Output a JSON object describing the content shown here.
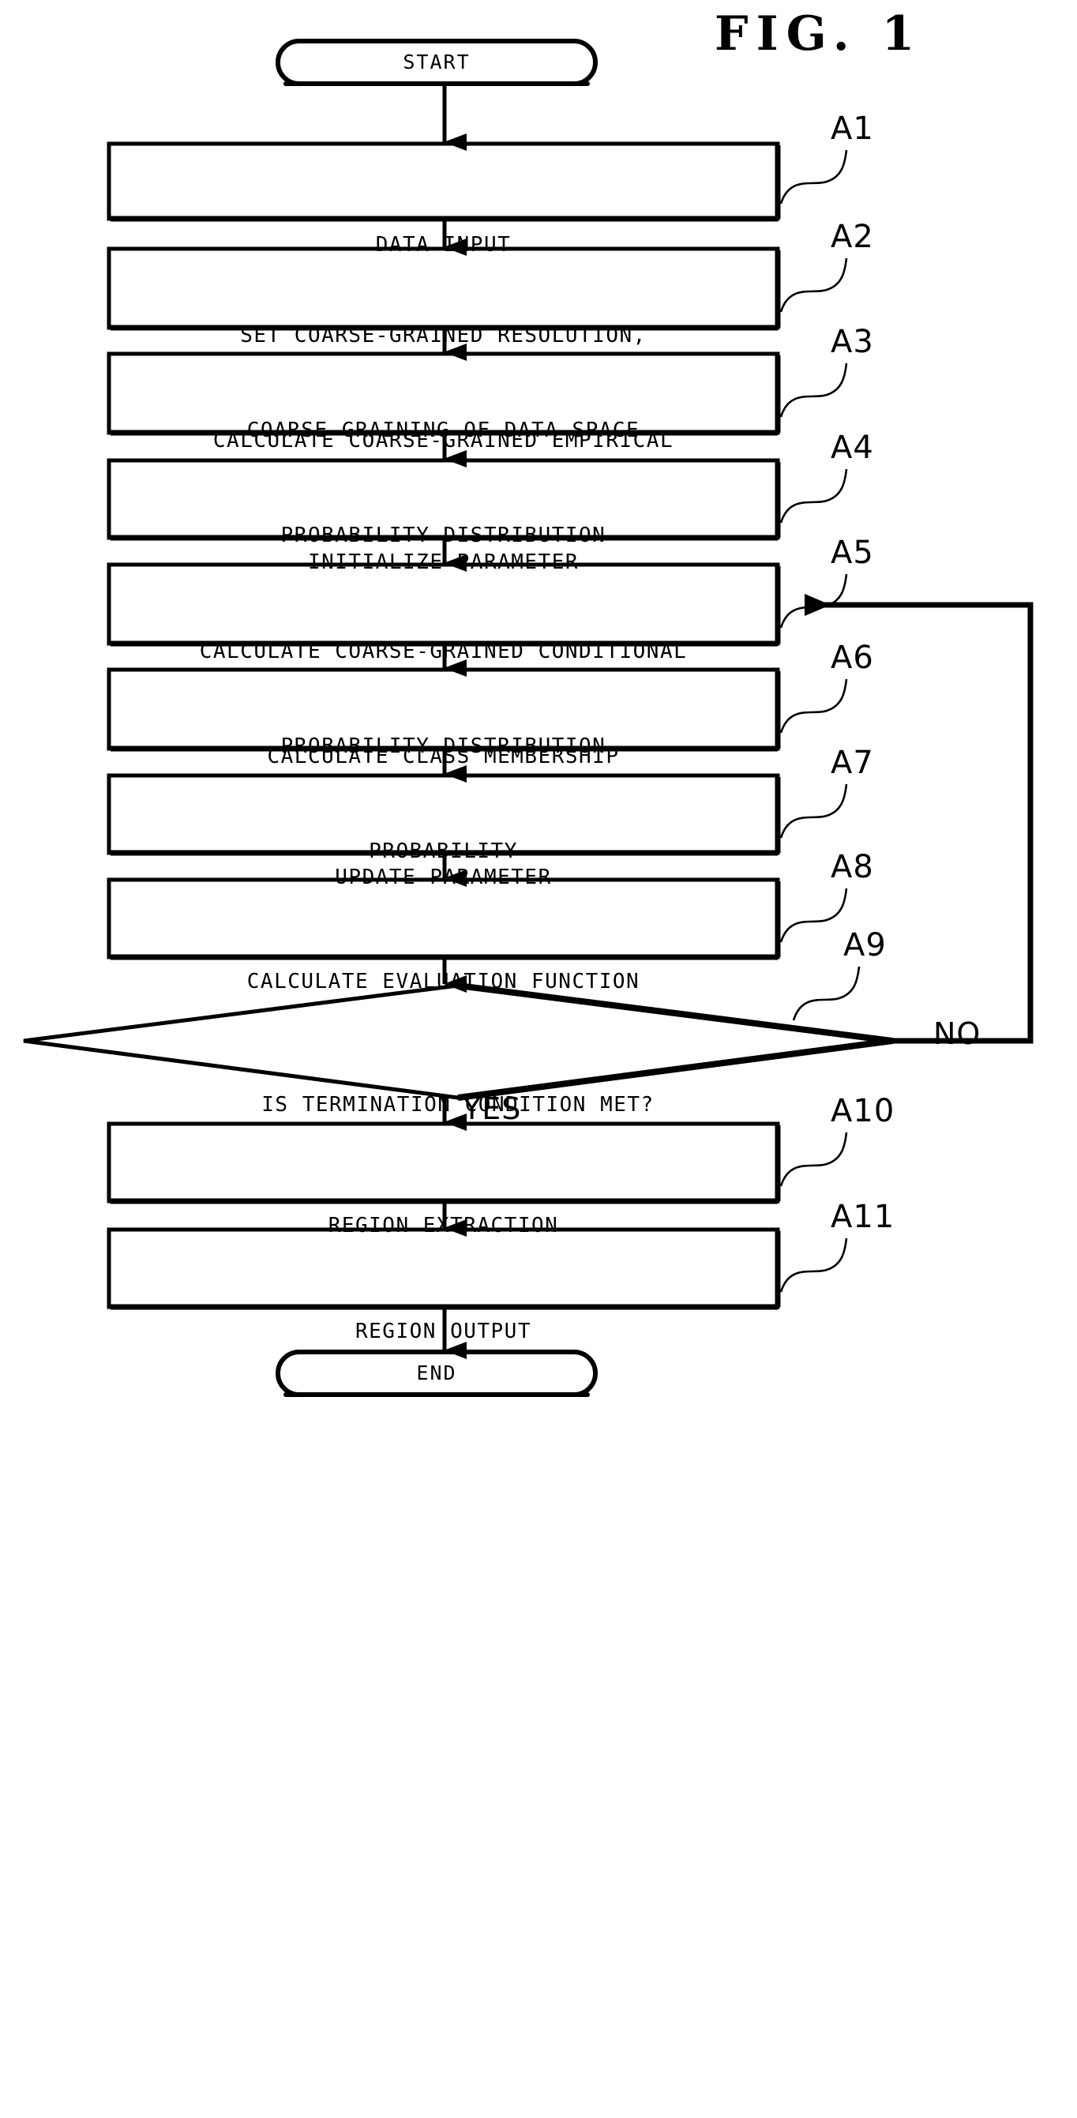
{
  "figure": {
    "title": "FIG. 1",
    "type": "flowchart"
  },
  "terminals": {
    "start": "START",
    "end": "END"
  },
  "branches": {
    "no": "NO",
    "yes": "YES"
  },
  "steps": [
    {
      "ref": "A1",
      "shape": "process",
      "lines": [
        "DATA INPUT"
      ]
    },
    {
      "ref": "A2",
      "shape": "process",
      "lines": [
        "SET COARSE-GRAINED RESOLUTION,",
        "COARSE-GRAINING OF DATA SPACE"
      ]
    },
    {
      "ref": "A3",
      "shape": "process",
      "lines": [
        "CALCULATE COARSE-GRAINED EMPIRICAL",
        "PROBABILITY DISTRIBUTION"
      ]
    },
    {
      "ref": "A4",
      "shape": "process",
      "lines": [
        "INITIALIZE PARAMETER"
      ]
    },
    {
      "ref": "A5",
      "shape": "process",
      "lines": [
        "CALCULATE COARSE-GRAINED CONDITIONAL",
        "PROBABILITY DISTRIBUTION"
      ]
    },
    {
      "ref": "A6",
      "shape": "process",
      "lines": [
        "CALCULATE CLASS MEMBERSHIP",
        "PROBABILITY"
      ]
    },
    {
      "ref": "A7",
      "shape": "process",
      "lines": [
        "UPDATE PARAMETER"
      ]
    },
    {
      "ref": "A8",
      "shape": "process",
      "lines": [
        "CALCULATE EVALUATION FUNCTION"
      ]
    },
    {
      "ref": "A9",
      "shape": "decision",
      "lines": [
        "IS TERMINATION CONDITION MET?"
      ]
    },
    {
      "ref": "A10",
      "shape": "process",
      "lines": [
        "REGION EXTRACTION"
      ]
    },
    {
      "ref": "A11",
      "shape": "process",
      "lines": [
        "REGION OUTPUT"
      ]
    }
  ],
  "colors": {
    "ink": "#000000",
    "paper": "#ffffff"
  }
}
